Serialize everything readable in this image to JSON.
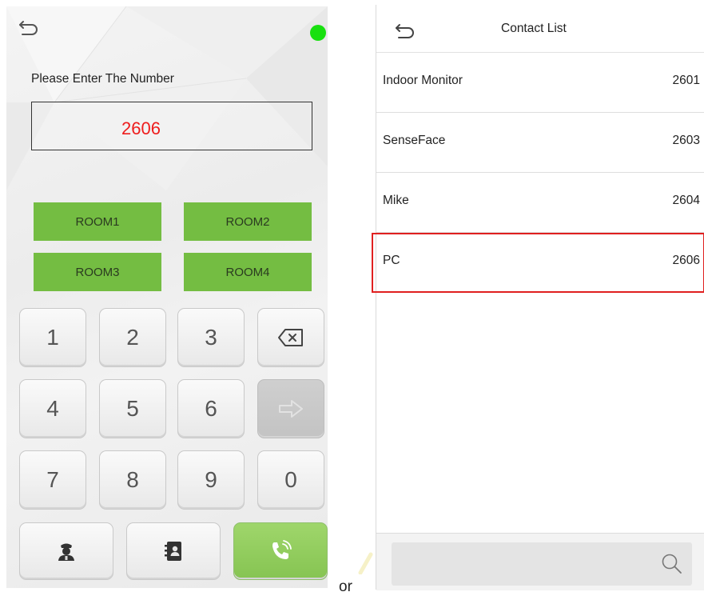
{
  "dialer": {
    "prompt": "Please Enter The Number",
    "number_value": "2606",
    "status_color": "#18e00f",
    "room_buttons": [
      "ROOM1",
      "ROOM2",
      "ROOM3",
      "ROOM4"
    ],
    "keys": [
      "1",
      "2",
      "3",
      "4",
      "5",
      "6",
      "7",
      "8",
      "9",
      "0"
    ],
    "icons": {
      "back": "back-arrow-icon",
      "backspace": "backspace-icon",
      "enter": "arrow-right-icon",
      "security": "security-guard-icon",
      "contacts": "contact-book-icon",
      "call": "phone-call-icon"
    },
    "accent_green": "#74bd42",
    "number_color": "#ee1c1c"
  },
  "separator": "or",
  "contact_list": {
    "title": "Contact List",
    "contacts": [
      {
        "name": "Indoor Monitor",
        "ext": "2601"
      },
      {
        "name": "SenseFace",
        "ext": "2603"
      },
      {
        "name": "Mike",
        "ext": "2604"
      },
      {
        "name": "PC",
        "ext": "2606"
      }
    ],
    "selected_ext": "2606",
    "highlight_color": "#e02020",
    "icons": {
      "back": "back-arrow-icon",
      "search": "search-icon"
    }
  }
}
